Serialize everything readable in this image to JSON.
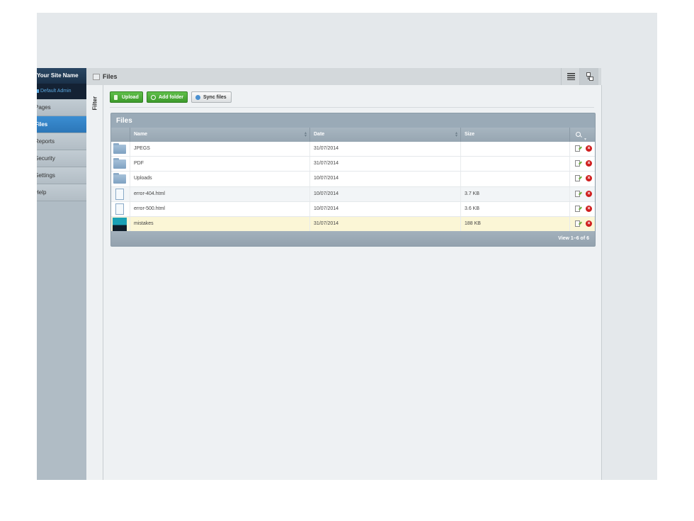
{
  "sidebar": {
    "site_name": "Your Site Name",
    "admin": "Default Admin",
    "items": [
      {
        "label": "Pages",
        "active": false
      },
      {
        "label": "Files",
        "active": true
      },
      {
        "label": "Reports",
        "active": false
      },
      {
        "label": "Security",
        "active": false
      },
      {
        "label": "Settings",
        "active": false
      },
      {
        "label": "Help",
        "active": false
      }
    ]
  },
  "header": {
    "title": "Files"
  },
  "filter": {
    "label": "Filter"
  },
  "toolbar": {
    "upload": "Upload",
    "add_folder": "Add folder",
    "sync": "Sync files"
  },
  "grid": {
    "title": "Files",
    "columns": {
      "name": "Name",
      "date": "Date",
      "size": "Size"
    },
    "rows": [
      {
        "type": "folder",
        "name": "JPEGS",
        "date": "31/07/2014",
        "size": ""
      },
      {
        "type": "folder",
        "name": "PDF",
        "date": "31/07/2014",
        "size": ""
      },
      {
        "type": "folder",
        "name": "Uploads",
        "date": "10/07/2014",
        "size": ""
      },
      {
        "type": "file",
        "name": "error-404.html",
        "date": "10/07/2014",
        "size": "3.7 KB"
      },
      {
        "type": "file",
        "name": "error-500.html",
        "date": "10/07/2014",
        "size": "3.6 KB"
      },
      {
        "type": "image",
        "name": "mistakes",
        "date": "31/07/2014",
        "size": "188 KB"
      }
    ],
    "pager": "View 1–6 of 6"
  },
  "colors": {
    "accent": "#2f80c3",
    "button_green": "#4aa837",
    "delete_red": "#cf1f1f"
  }
}
